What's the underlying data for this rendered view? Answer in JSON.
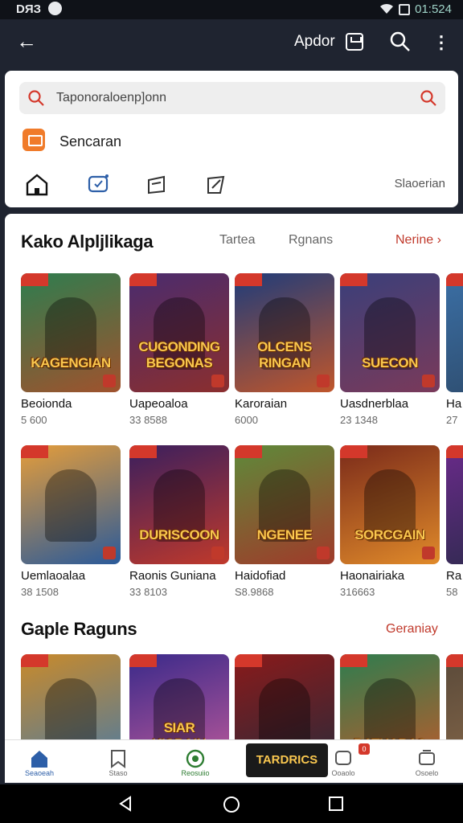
{
  "status": {
    "time": "DЯЗ",
    "clock": "01:524"
  },
  "appbar": {
    "title": "Apdor"
  },
  "search": {
    "value": "Taponoraloenp]onn"
  },
  "suggestion": {
    "label": "Sencaran"
  },
  "tabs": {
    "right_label": "Slaoerian"
  },
  "section1": {
    "title": "Kako Alpljlikaga",
    "filters": [
      "Tartea",
      "Rgnans"
    ],
    "more": "Nerine ›",
    "row1": [
      {
        "title": "KAGENGIAN",
        "name": "Beoionda",
        "meta": "5 600",
        "colors": [
          "#2e7d4f",
          "#a0522d"
        ]
      },
      {
        "title": "CUGONDING BEGONAS",
        "name": "Uapeoaloa",
        "meta": "33 8588",
        "colors": [
          "#4a2c6e",
          "#8b2e2e"
        ]
      },
      {
        "title": "OLCENS RINGAN",
        "name": "Karoraian",
        "meta": "6000",
        "colors": [
          "#1f3c7a",
          "#c0562b"
        ]
      },
      {
        "title": "SUECON",
        "name": "Uasdnerblaa",
        "meta": "23 1348",
        "colors": [
          "#3a3f7a",
          "#7a3a5a"
        ]
      },
      {
        "title": "",
        "name": "Ha",
        "meta": "27",
        "colors": [
          "#3b6fa5",
          "#2d4a6a"
        ]
      }
    ],
    "row2": [
      {
        "title": "",
        "name": "Uemlaoalaa",
        "meta": "38 1508",
        "colors": [
          "#e59d3a",
          "#2a5a9a"
        ]
      },
      {
        "title": "DURISCOON",
        "name": "Raonis Guniana",
        "meta": "33 8103",
        "colors": [
          "#3a1f5e",
          "#c0392b"
        ]
      },
      {
        "title": "NGENEE",
        "name": "Haidofiad",
        "meta": "S8.9868",
        "colors": [
          "#5e8a3a",
          "#a03a2a"
        ]
      },
      {
        "title": "SORCGAIN",
        "name": "Haonairiaka",
        "meta": "316663",
        "colors": [
          "#7a2a1a",
          "#e08a2a"
        ]
      },
      {
        "title": "",
        "name": "Ra",
        "meta": "58",
        "colors": [
          "#6a2a8a",
          "#2a2a4a"
        ]
      }
    ]
  },
  "section2": {
    "title": "Gaple Raguns",
    "more": "Geraniay",
    "row": [
      {
        "title": "",
        "colors": [
          "#c98a2a",
          "#4a7aa5"
        ]
      },
      {
        "title": "SIAR KICRAIN",
        "colors": [
          "#3a2a8a",
          "#c05a9a"
        ]
      },
      {
        "title": "",
        "colors": [
          "#8a1a1a",
          "#2a2a3a"
        ]
      },
      {
        "title": "RATHARAS",
        "colors": [
          "#2e7d4f",
          "#c05a2a"
        ]
      },
      {
        "title": "",
        "colors": [
          "#5a4a3a",
          "#8a6a4a"
        ]
      }
    ]
  },
  "bottomnav": {
    "items": [
      {
        "label": "Seaoeah",
        "icon": "home-icon"
      },
      {
        "label": "Staso",
        "icon": "bookmark-icon"
      },
      {
        "label": "Reosuiio",
        "icon": "target-icon"
      },
      {
        "label": "Ooaolo",
        "icon": "notification-icon"
      },
      {
        "label": "Osoelo",
        "icon": "square-icon"
      }
    ],
    "banner": "TARDRICS",
    "notification_count": "0"
  },
  "colors": {
    "accent": "#2d5fa8",
    "danger": "#c0392b",
    "appbar": "#1f2430"
  }
}
